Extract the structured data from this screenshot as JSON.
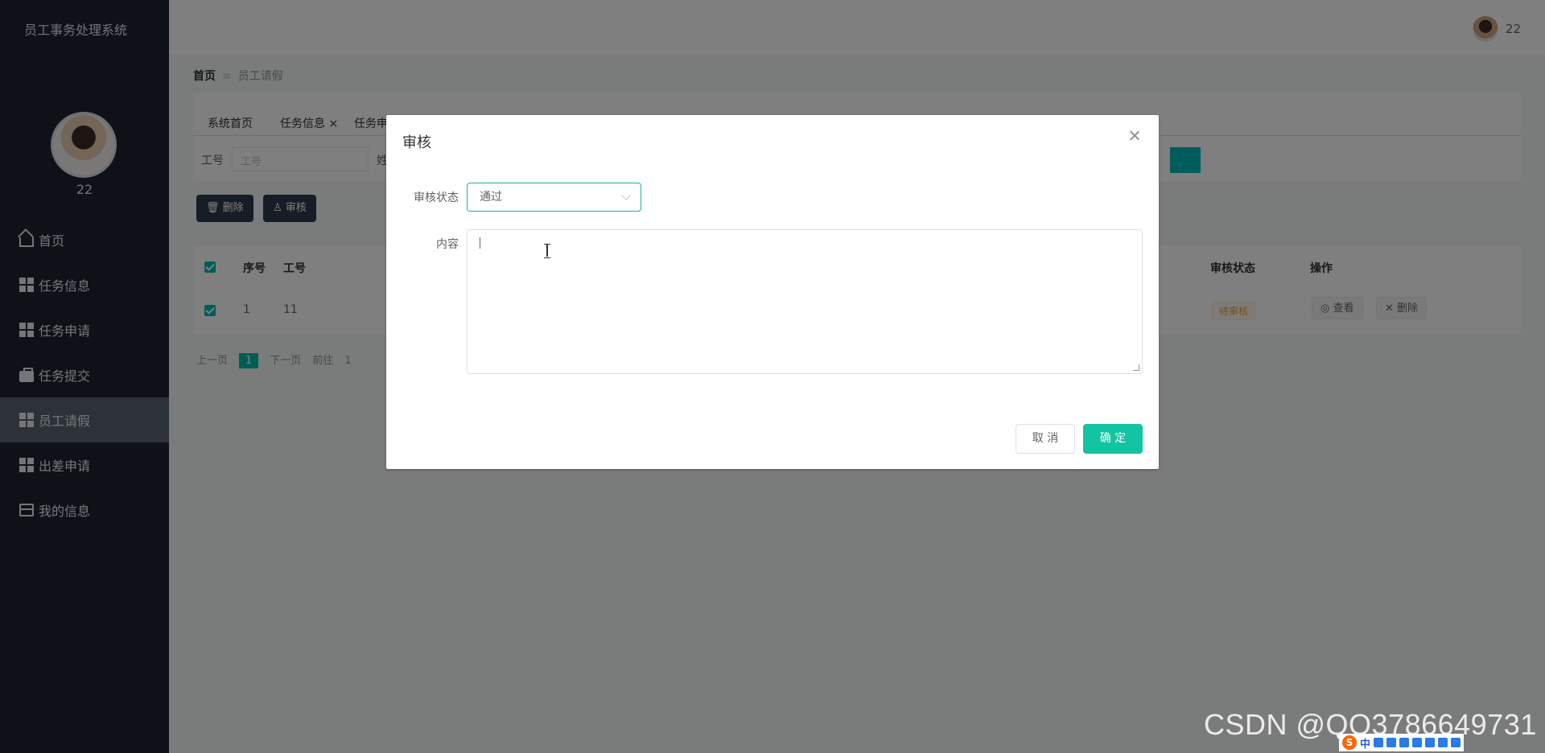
{
  "app": {
    "title": "员工事务处理系统"
  },
  "user": {
    "name": "22"
  },
  "sidebar": {
    "items": [
      {
        "label": "首页",
        "icon": "home-icon"
      },
      {
        "label": "任务信息",
        "icon": "grid-icon"
      },
      {
        "label": "任务申请",
        "icon": "grid-icon"
      },
      {
        "label": "任务提交",
        "icon": "briefcase-icon"
      },
      {
        "label": "员工请假",
        "icon": "grid-icon",
        "active": true
      },
      {
        "label": "出差申请",
        "icon": "grid-icon"
      },
      {
        "label": "我的信息",
        "icon": "card-icon"
      }
    ]
  },
  "breadcrumb": {
    "home": "首页",
    "current": "员工请假"
  },
  "tabs": [
    "系统首页",
    "任务信息",
    "任务申请"
  ],
  "search": {
    "label": "工号",
    "placeholder": "工号",
    "label2": "姓"
  },
  "toolbar": {
    "delete": "删除",
    "audit": "审核"
  },
  "table": {
    "headers": {
      "index": "序号",
      "job_no": "工号",
      "audit_status": "审核状态",
      "actions": "操作"
    },
    "rows": [
      {
        "index": "1",
        "job_no": "11",
        "status": "待审核",
        "view": "查看",
        "delete": "删除"
      }
    ]
  },
  "pager": {
    "prev": "上一页",
    "current": "1",
    "next": "下一页",
    "goto": "前往",
    "goto_val": "1"
  },
  "dialog": {
    "title": "审核",
    "status_label": "审核状态",
    "status_value": "通过",
    "content_label": "内容",
    "cancel": "取 消",
    "ok": "确 定"
  },
  "watermark": "CSDN @QQ3786649731",
  "tray": {
    "lang": "中",
    "logo": "S"
  },
  "colors": {
    "sidebar_bg": "#1c2431",
    "accent": "#13c4a3",
    "overlay": "rgba(0,0,0,0.5)"
  }
}
